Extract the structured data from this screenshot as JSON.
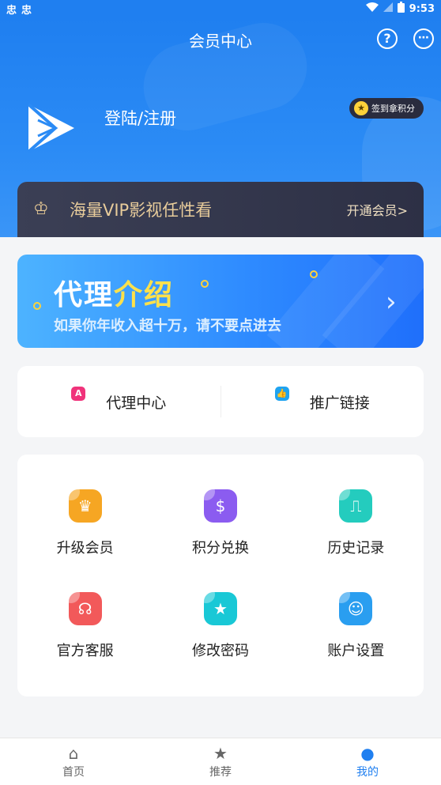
{
  "status_bar": {
    "left_icons": [
      "忠",
      "忠"
    ],
    "time": "9:53"
  },
  "header": {
    "title": "会员中心",
    "login_text": "登陆/注册",
    "checkin_label": "签到拿积分"
  },
  "vip": {
    "text": "海量VIP影视任性看",
    "open_label": "开通会员>"
  },
  "agent_banner": {
    "title_plain": "代理",
    "title_highlight": "介绍",
    "subtitle": "如果你年收入超十万，请不要点进去"
  },
  "links": [
    {
      "label": "代理中心",
      "icon": "agent-center-icon",
      "color": "#f0337b",
      "glyph": "A"
    },
    {
      "label": "推广链接",
      "icon": "promote-link-icon",
      "color": "#1fa3f0",
      "glyph": "👍"
    }
  ],
  "grid": [
    {
      "label": "升级会员",
      "icon": "upgrade-member-icon",
      "color": "#f6a623",
      "glyph": "♛"
    },
    {
      "label": "积分兑换",
      "icon": "points-exchange-icon",
      "color": "#8b5cf0",
      "glyph": "$"
    },
    {
      "label": "历史记录",
      "icon": "history-icon",
      "color": "#24ccbe",
      "glyph": "⎍"
    },
    {
      "label": "官方客服",
      "icon": "customer-service-icon",
      "color": "#f2595a",
      "glyph": "☊"
    },
    {
      "label": "修改密码",
      "icon": "change-password-icon",
      "color": "#19c8d6",
      "glyph": "★"
    },
    {
      "label": "账户设置",
      "icon": "account-settings-icon",
      "color": "#2a9ef0",
      "glyph": "☺"
    }
  ],
  "tabs": [
    {
      "label": "首页",
      "icon": "home-icon",
      "glyph": "⌂",
      "active": false
    },
    {
      "label": "推荐",
      "icon": "star-icon",
      "glyph": "★",
      "active": false
    },
    {
      "label": "我的",
      "icon": "profile-icon",
      "glyph": "●",
      "active": true
    }
  ],
  "colors": {
    "primary": "#1f7ff0",
    "vip_gold": "#e8cc9b",
    "highlight": "#ffe14a"
  }
}
